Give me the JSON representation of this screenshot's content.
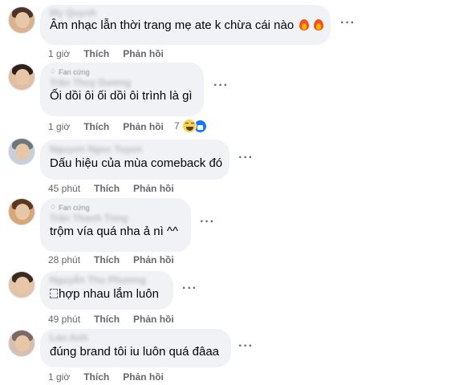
{
  "comments": [
    {
      "name": "My Quynh",
      "badge": "",
      "text": "Âm nhạc lẫn thời trang mẹ ate k chừa cái nào",
      "time": "1 giờ",
      "like_label": "Thích",
      "reply_label": "Phản hồi",
      "reaction_count": "",
      "avatar_colors": [
        "#d9b38c",
        "#4a342a"
      ]
    },
    {
      "name": "Trần Thuy Dương",
      "badge": "Fan cứng",
      "text": "Ối dồi ôi ối dồi ôi trình là gì",
      "time": "1 giờ",
      "like_label": "Thích",
      "reply_label": "Phản hồi",
      "reaction_count": "7",
      "avatar_colors": [
        "#e0bfa4",
        "#2e211c"
      ]
    },
    {
      "name": "Nguyen Ngoc Tuyen",
      "badge": "",
      "text": "Dấu hiệu của mùa comeback đó",
      "time": "45 phút",
      "like_label": "Thích",
      "reply_label": "Phản hồi",
      "reaction_count": "",
      "avatar_colors": [
        "#c9cfd6",
        "#6d7780"
      ]
    },
    {
      "name": "Trần Thanh Tùng",
      "badge": "Fan cứng",
      "text": "trộm vía quá nha ả nì ^^",
      "time": "28 phút",
      "like_label": "Thích",
      "reply_label": "Phản hồi",
      "reaction_count": "",
      "avatar_colors": [
        "#d7a77a",
        "#5a3b22"
      ]
    },
    {
      "name": "Nguyễn Thu Phương",
      "badge": "",
      "text": "hợp nhau lắm luôn",
      "time": "49 phút",
      "like_label": "Thích",
      "reply_label": "Phản hồi",
      "reaction_count": "",
      "avatar_colors": [
        "#e2c4ad",
        "#3a2a20"
      ]
    },
    {
      "name": "Lan Anh",
      "badge": "",
      "text": "đúng brand tôi iu luôn quá đâaa",
      "time": "1 giờ",
      "like_label": "Thích",
      "reply_label": "Phản hồi",
      "reaction_count": "",
      "avatar_colors": [
        "#d8c0b0",
        "#7a6a66"
      ]
    }
  ],
  "icons": {
    "more": "more-options-icon",
    "fire": "fire-emoji",
    "haha": "haha-reaction-icon",
    "like": "like-reaction-icon",
    "badge": "diamond-icon"
  }
}
